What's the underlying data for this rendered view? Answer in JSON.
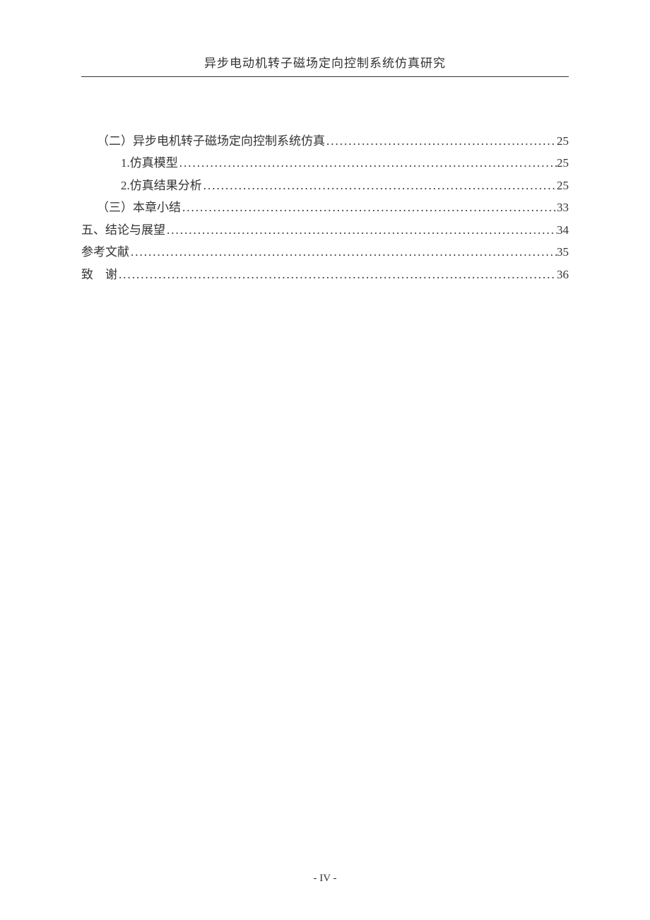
{
  "header": {
    "title": "异步电动机转子磁场定向控制系统仿真研究"
  },
  "toc": {
    "entries": [
      {
        "label": "（二）异步电机转子磁场定向控制系统仿真",
        "page": "25",
        "indent": 1
      },
      {
        "label": "1.仿真模型",
        "page": "25",
        "indent": 2
      },
      {
        "label": "2.仿真结果分析",
        "page": "25",
        "indent": 2
      },
      {
        "label": "（三）本章小结",
        "page": "33",
        "indent": 1
      },
      {
        "label": "五、结论与展望",
        "page": "34",
        "indent": 0
      },
      {
        "label": "参考文献",
        "page": "35",
        "indent": 0
      },
      {
        "label": "致　谢",
        "page": "36",
        "indent": 0,
        "ack": true
      }
    ]
  },
  "footer": {
    "page_number": "- IV -"
  }
}
